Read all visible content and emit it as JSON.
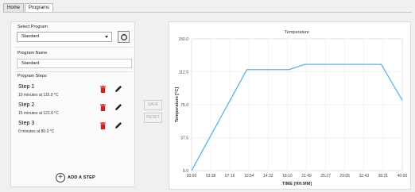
{
  "tabs": [
    {
      "label": "Home"
    },
    {
      "label": "Programs"
    }
  ],
  "left": {
    "select_program_label": "Select Program",
    "selected_program": "Standard",
    "program_name_label": "Program Name",
    "program_name_value": "Standard",
    "program_steps_label": "Program Steps",
    "steps": [
      {
        "name": "Step 1",
        "desc": "10 minutes at 115.0 °C"
      },
      {
        "name": "Step 2",
        "desc": "15 minutes at 121.0 °C"
      },
      {
        "name": "Step 3",
        "desc": "0 minutes at 80.0 °C"
      }
    ],
    "add_step_label": "ADD A STEP"
  },
  "buttons": {
    "save": "SAVE",
    "reset": "RESET"
  },
  "colors": {
    "line": "#5ab4e8",
    "delete": "#d62020",
    "grid": "#e6e6e6"
  },
  "chart_data": {
    "type": "line",
    "title": "Temperature",
    "xlabel": "TIME [HH:MM]",
    "ylabel": "Temperature [°C]",
    "ylim": [
      0,
      150
    ],
    "xlim": [
      "00:00",
      "40:00"
    ],
    "yticks": [
      "0.0",
      "37.5",
      "75.0",
      "112.5",
      "150.0"
    ],
    "xticks": [
      "00:00",
      "03:38",
      "07:16",
      "10:54",
      "14:32",
      "18:10",
      "21:49",
      "25:27",
      "29:05",
      "32:43",
      "36:21",
      "40:00"
    ],
    "grid": true,
    "series": [
      {
        "x": [
          "00:00",
          "10:30",
          "11:30",
          "18:30",
          "21:30",
          "35:00",
          "36:00",
          "40:00"
        ],
        "values": [
          0,
          115,
          115,
          115,
          121,
          121,
          121,
          80
        ]
      }
    ]
  }
}
